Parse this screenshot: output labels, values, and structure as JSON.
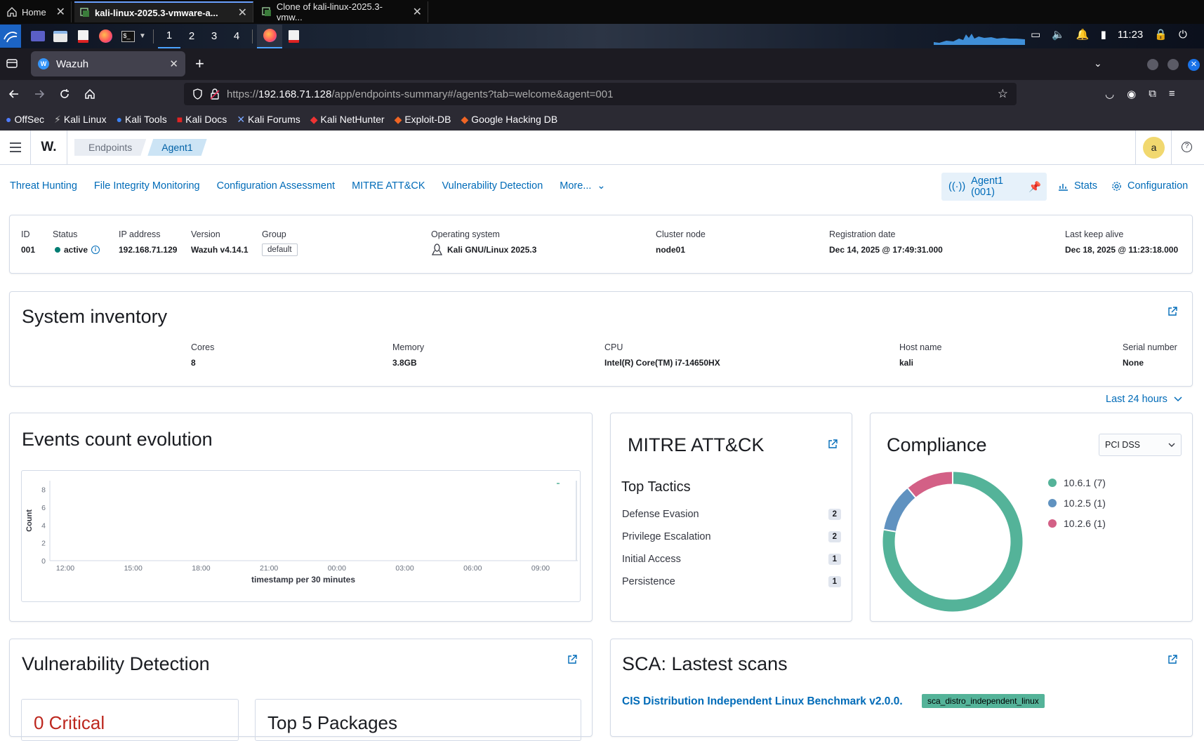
{
  "vm_tabs": [
    {
      "label": "Home",
      "active": false
    },
    {
      "label": "kali-linux-2025.3-vmware-a...",
      "active": true
    },
    {
      "label": "Clone of kali-linux-2025.3-vmw...",
      "active": false
    }
  ],
  "panel": {
    "workspaces": [
      "1",
      "2",
      "3",
      "4"
    ],
    "clock": "11:23"
  },
  "browser": {
    "tab_title": "Wazuh",
    "url_prefix": "https://",
    "url_host": "192.168.71.128",
    "url_path": "/app/endpoints-summary#/agents?tab=welcome&agent=001",
    "bookmarks": [
      "OffSec",
      "Kali Linux",
      "Kali Tools",
      "Kali Docs",
      "Kali Forums",
      "Kali NetHunter",
      "Exploit-DB",
      "Google Hacking DB"
    ]
  },
  "topbar": {
    "logo": "W.",
    "breadcrumb": [
      "Endpoints",
      "Agent1"
    ],
    "avatar": "a"
  },
  "module_nav": {
    "items": [
      "Threat Hunting",
      "File Integrity Monitoring",
      "Configuration Assessment",
      "MITRE ATT&CK",
      "Vulnerability Detection",
      "More..."
    ],
    "agent_pill": "Agent1 (001)",
    "stats": "Stats",
    "configuration": "Configuration"
  },
  "agent_info": {
    "id": {
      "label": "ID",
      "value": "001"
    },
    "status": {
      "label": "Status",
      "value": "active"
    },
    "ip": {
      "label": "IP address",
      "value": "192.168.71.129"
    },
    "version": {
      "label": "Version",
      "value": "Wazuh v4.14.1"
    },
    "group": {
      "label": "Group",
      "value": "default"
    },
    "os": {
      "label": "Operating system",
      "value": "Kali GNU/Linux 2025.3"
    },
    "cluster": {
      "label": "Cluster node",
      "value": "node01"
    },
    "registration": {
      "label": "Registration date",
      "value": "Dec 14, 2025 @ 17:49:31.000"
    },
    "keepalive": {
      "label": "Last keep alive",
      "value": "Dec 18, 2025 @ 11:23:18.000"
    }
  },
  "inventory": {
    "title": "System inventory",
    "cores": {
      "label": "Cores",
      "value": "8"
    },
    "memory": {
      "label": "Memory",
      "value": "3.8GB"
    },
    "cpu": {
      "label": "CPU",
      "value": "Intel(R) Core(TM) i7-14650HX"
    },
    "hostname": {
      "label": "Host name",
      "value": "kali"
    },
    "serial": {
      "label": "Serial number",
      "value": "None"
    }
  },
  "time_filter": "Last 24 hours",
  "events": {
    "title": "Events count evolution"
  },
  "mitre": {
    "title": "MITRE ATT&CK",
    "subtitle": "Top Tactics",
    "tactics": [
      {
        "name": "Defense Evasion",
        "count": "2"
      },
      {
        "name": "Privilege Escalation",
        "count": "2"
      },
      {
        "name": "Initial Access",
        "count": "1"
      },
      {
        "name": "Persistence",
        "count": "1"
      }
    ]
  },
  "compliance": {
    "title": "Compliance",
    "select": "PCI DSS"
  },
  "vuln": {
    "title": "Vulnerability Detection",
    "critical_partial": "0 Critical",
    "top_partial": "Top 5 Packages"
  },
  "sca": {
    "title": "SCA: Lastest scans",
    "policy_link": "CIS Distribution Independent Linux Benchmark v2.0.0.",
    "policy_id": "sca_distro_independent_linux"
  },
  "colors": {
    "accent": "#006bb8",
    "active": "#017d73",
    "teal": "#54b399",
    "blue": "#6092c0",
    "pink": "#d36086"
  },
  "chart_data": [
    {
      "type": "line",
      "ylabel": "Count",
      "xlabel": "timestamp per 30 minutes",
      "x_ticks": [
        "12:00",
        "15:00",
        "18:00",
        "21:00",
        "00:00",
        "03:00",
        "06:00",
        "09:00"
      ],
      "y_ticks": [
        0,
        2,
        4,
        6,
        8
      ],
      "ylim": [
        0,
        9
      ],
      "series": [
        {
          "x": [
            "11:00"
          ],
          "values": [
            9
          ]
        }
      ]
    },
    {
      "type": "pie",
      "labels": [
        "10.6.1",
        "10.2.5",
        "10.2.6"
      ],
      "values": [
        7,
        1,
        1
      ],
      "legend": [
        "10.6.1 (7)",
        "10.2.5 (1)",
        "10.2.6 (1)"
      ],
      "colors": [
        "#54b399",
        "#6092c0",
        "#d36086"
      ]
    }
  ]
}
